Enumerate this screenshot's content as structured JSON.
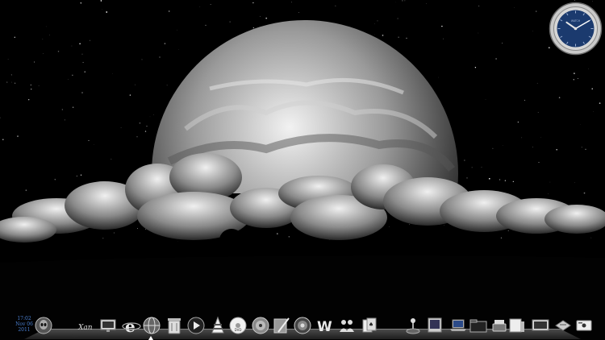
{
  "taskbar": {
    "time": "17:02",
    "date": "Nov 06",
    "year": "2011"
  },
  "clock": {
    "brand": "WATCH",
    "hours": 10,
    "minutes": 10
  },
  "dock": {
    "icons": [
      "alien-icon",
      "xanadu-logo-icon",
      "monitor-icon",
      "internet-explorer-icon",
      "globe-icon",
      "trash-icon",
      "media-player-icon",
      "vlc-icon",
      "dvd-icon",
      "disc-icon",
      "paint-icon",
      "target-icon",
      "word-icon",
      "people-icon",
      "cards-icon",
      "joystick-icon",
      "display-icon",
      "laptop-icon",
      "folder-icon",
      "phone-icon",
      "monitor-2-icon",
      "tray-icon",
      "notepad-icon",
      "system-icon"
    ]
  },
  "colors": {
    "sky": "#000000",
    "moon": "#d8d8d8",
    "clock_face": "#1b3a6e",
    "date_text": "#4a7fd0"
  }
}
